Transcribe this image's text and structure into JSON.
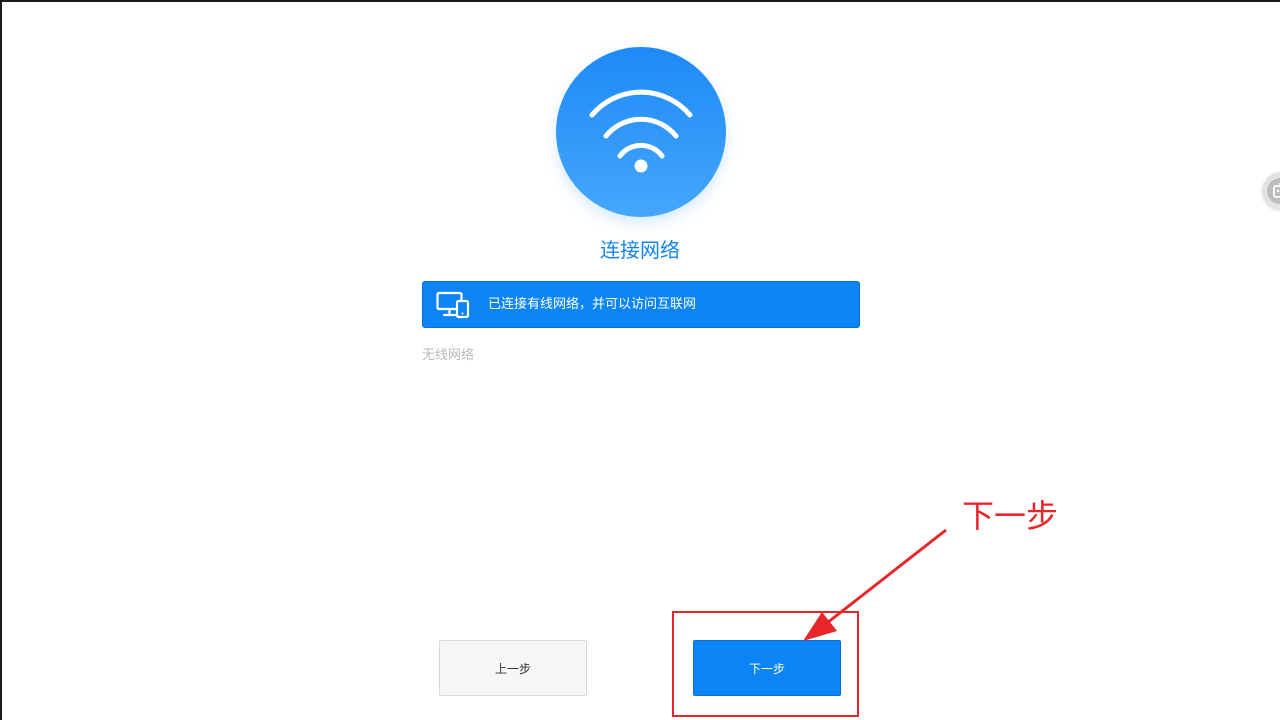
{
  "title": "连接网络",
  "wired": {
    "status_text": "已连接有线网络，并可以访问互联网",
    "icon": "monitor-phone-icon"
  },
  "wireless": {
    "section_label": "无线网络"
  },
  "buttons": {
    "prev_label": "上一步",
    "next_label": "下一步"
  },
  "annotation": {
    "label": "下一步"
  },
  "icons": {
    "hero": "wifi-icon",
    "side": "side-assistant-icon"
  },
  "colors": {
    "accent": "#0c84f5",
    "title": "#1485ee",
    "annotation": "#e8262a"
  }
}
